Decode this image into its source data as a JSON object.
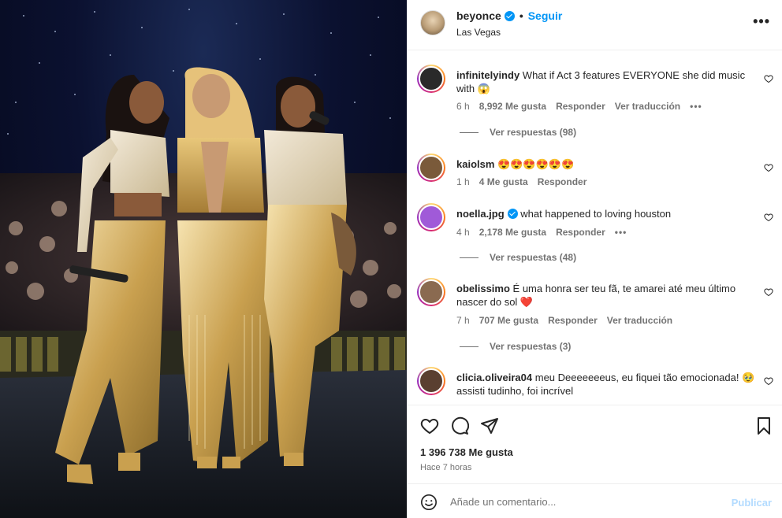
{
  "post": {
    "username": "beyonce",
    "follow_label": "Seguir",
    "location": "Las Vegas",
    "more_label": "•••"
  },
  "comments": [
    {
      "username": "infinitelyindy",
      "text": "What if Act 3 features EVERYONE she did music with 😱",
      "time": "6 h",
      "likes": "8,992 Me gusta",
      "reply": "Responder",
      "translate": "Ver traducción",
      "more": "•••",
      "replies": "Ver respuestas (98)",
      "avatar_color": "#2a2a2a"
    },
    {
      "username": "kaiolsm",
      "text": "😍😍😍😍😍😍",
      "time": "1 h",
      "likes": "4 Me gusta",
      "reply": "Responder",
      "avatar_color": "#7a5a3a"
    },
    {
      "username": "noella.jpg",
      "text": "what happened to loving houston",
      "time": "4 h",
      "likes": "2,178 Me gusta",
      "reply": "Responder",
      "more": "•••",
      "replies": "Ver respuestas (48)",
      "avatar_color": "#a05ad8"
    },
    {
      "username": "obelissimo",
      "text": "É uma honra ser teu fã, te amarei até meu último nascer do sol ❤️",
      "time": "7 h",
      "likes": "707 Me gusta",
      "reply": "Responder",
      "translate": "Ver traducción",
      "replies": "Ver respuestas (3)",
      "avatar_color": "#8a6a50"
    },
    {
      "username": "clicia.oliveira04",
      "text": "meu Deeeeeeeus, eu fiquei tão emocionada! 🥹 assisti tudinho, foi incrível",
      "avatar_color": "#5a3f30"
    }
  ],
  "actions": {
    "likes_count": "1 396 738 Me gusta",
    "time_ago": "Hace 7 horas"
  },
  "add_comment": {
    "placeholder": "Añade un comentario...",
    "publish_label": "Publicar"
  },
  "colors": {
    "accent": "#0095f6",
    "publish_disabled": "#b3dbff",
    "meta": "#737373"
  }
}
